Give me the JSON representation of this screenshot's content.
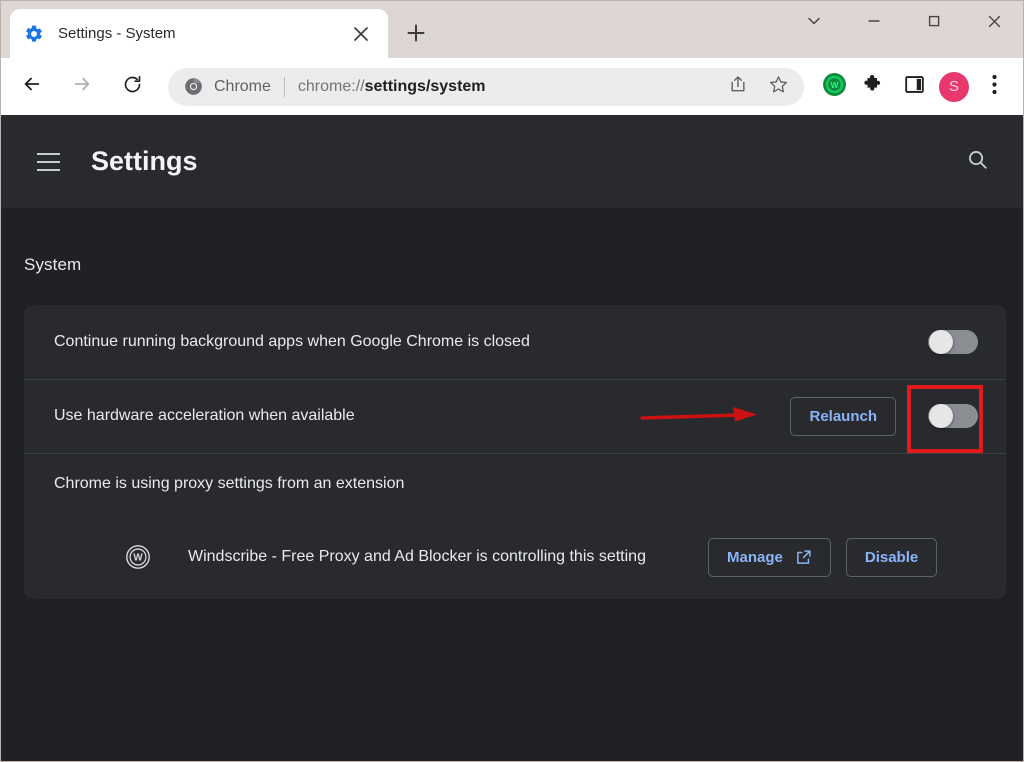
{
  "window": {
    "controls": {
      "tab_search_label": "Tab search",
      "minimize_label": "Minimize",
      "maximize_label": "Maximize",
      "close_label": "Close"
    }
  },
  "tabstrip": {
    "tab": {
      "title": "Settings - System",
      "favicon": "gear-icon",
      "close_label": "Close tab"
    },
    "new_tab_label": "New tab"
  },
  "toolbar": {
    "back_label": "Back",
    "forward_label": "Forward",
    "reload_label": "Reload",
    "omnibox": {
      "chrome_icon": "chrome-logo-icon",
      "chrome_label": "Chrome",
      "url_prefix": "chrome://",
      "url_bold": "settings/system",
      "share_label": "Share this page",
      "bookmark_label": "Bookmark this tab"
    },
    "extension_windscribe_label": "Windscribe",
    "extensions_label": "Extensions",
    "side_panel_label": "Side panel",
    "profile_initial": "S",
    "menu_label": "Customize and control Google Chrome"
  },
  "settings": {
    "header": {
      "menu_label": "Main menu",
      "title": "Settings",
      "search_label": "Search settings"
    },
    "section_title": "System",
    "rows": [
      {
        "label": "Continue running background apps when Google Chrome is closed",
        "control": "toggle",
        "toggle_state": "off"
      },
      {
        "label": "Use hardware acceleration when available",
        "control": "toggle",
        "toggle_state": "off",
        "button_label": "Relaunch"
      },
      {
        "label": "Chrome is using proxy settings from an extension"
      }
    ],
    "extension": {
      "icon": "windscribe-icon",
      "name": "Windscribe - Free Proxy and Ad Blocker is controlling this setting",
      "manage_label": "Manage",
      "manage_icon": "external-link-icon",
      "disable_label": "Disable"
    }
  },
  "annotations": {
    "arrow": {
      "name": "red-arrow-annotation",
      "color": "#cc1111"
    },
    "box": {
      "name": "red-highlight-box-annotation",
      "color": "#e01b1b"
    }
  },
  "colors": {
    "page_bg": "#202124",
    "card_bg": "#292a2d",
    "accent_blue": "#8ab4f8",
    "text_primary": "#e8eaed",
    "annotation_red": "#e01b1b",
    "avatar_pink": "#e8386e",
    "windscribe_green": "#1db954"
  }
}
